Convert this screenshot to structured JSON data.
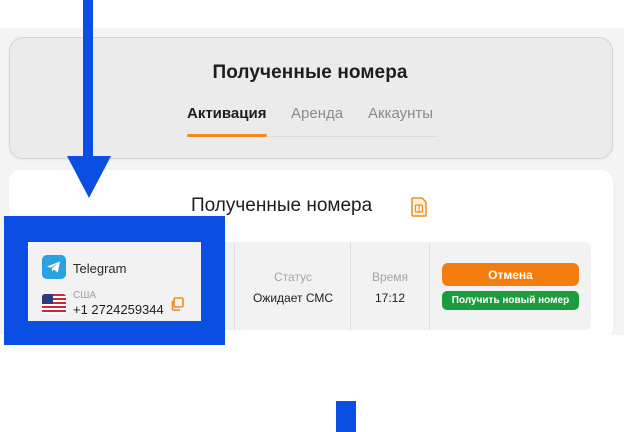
{
  "header": {
    "title": "Полученные номера",
    "tabs": [
      {
        "label": "Активация",
        "active": true
      },
      {
        "label": "Аренда",
        "active": false
      },
      {
        "label": "Аккаунты",
        "active": false
      }
    ]
  },
  "main": {
    "title": "Полученные номера",
    "title_icon": "sim-card-icon",
    "rows": [
      {
        "service": {
          "name": "Telegram",
          "icon": "telegram-icon"
        },
        "country": {
          "name": "США",
          "flag": "us-flag-icon"
        },
        "phone": "+1 2724259344",
        "status_label": "Статус",
        "status_value": "Ожидает СМС",
        "time_label": "Время",
        "time_value": "17:12",
        "cancel_label": "Отмена",
        "new_number_label": "Получить новый номер"
      }
    ]
  },
  "colors": {
    "accent_orange": "#f57d0e",
    "green": "#1c9c3d",
    "annotation_blue": "#0a4ee4",
    "telegram_blue": "#2aa1e2"
  }
}
